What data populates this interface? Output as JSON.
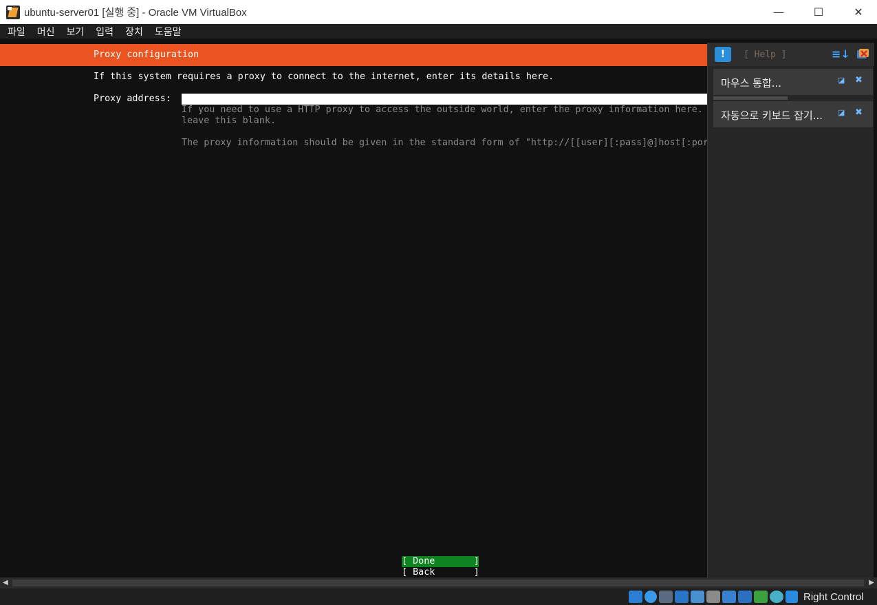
{
  "window": {
    "title": "ubuntu-server01 [실행 중] - Oracle VM VirtualBox",
    "minimize_glyph": "—",
    "maximize_glyph": "☐",
    "close_glyph": "✕"
  },
  "menu": {
    "items": [
      "파일",
      "머신",
      "보기",
      "입력",
      "장치",
      "도움말"
    ]
  },
  "installer": {
    "header": "Proxy configuration",
    "intro": "If this system requires a proxy to connect to the internet, enter its details here.",
    "proxy_label": "Proxy address:",
    "proxy_value": "",
    "help_line1": "If you need to use a HTTP proxy to access the outside world, enter the proxy information here. O",
    "help_line2": "leave this blank.",
    "help_line3": "The proxy information should be given in the standard form of \"http://[[user][:pass]@]host[:port]/\".",
    "done_button": "[ Done       ]",
    "back_button": "[ Back       ]"
  },
  "panel": {
    "help_label": "[ Help ]",
    "notifications": [
      {
        "text": "마우스 통합..."
      },
      {
        "text": "자동으로 키보드 잡기..."
      }
    ]
  },
  "statusbar": {
    "host_key": "Right Control",
    "icons": [
      "hdd-icon",
      "optical-icon",
      "audio-icon",
      "network-icon",
      "usb-icon",
      "shared-folder-icon",
      "display-icon",
      "recording-icon",
      "cpu-icon",
      "mouse-integration-icon",
      "keyboard-capture-icon"
    ]
  },
  "colors": {
    "accent_orange": "#e95420",
    "done_green": "#0e8420"
  }
}
